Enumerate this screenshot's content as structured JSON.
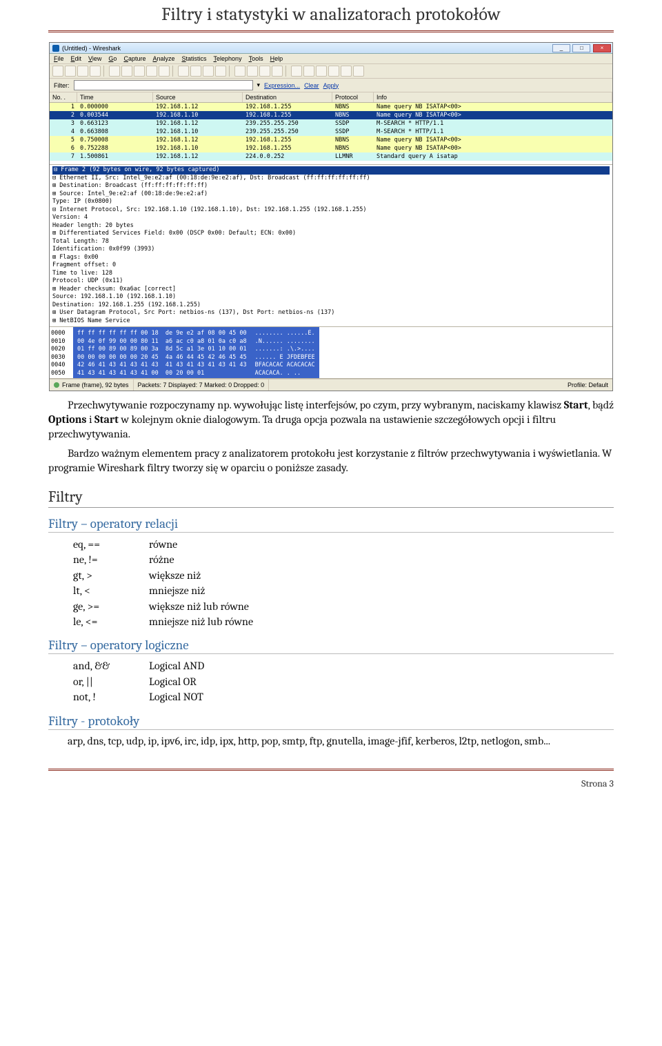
{
  "page": {
    "title": "Filtry i statystyki w analizatorach protokołów",
    "footer": "Strona 3"
  },
  "wireshark": {
    "window_title": "(Untitled) - Wireshark",
    "menu": [
      "File",
      "Edit",
      "View",
      "Go",
      "Capture",
      "Analyze",
      "Statistics",
      "Telephony",
      "Tools",
      "Help"
    ],
    "filter_label": "Filter:",
    "expression": "Expression...",
    "clear": "Clear",
    "apply": "Apply",
    "columns": {
      "no": "No. .",
      "time": "Time",
      "src": "Source",
      "dst": "Destination",
      "proto": "Protocol",
      "info": "Info"
    },
    "rows": [
      {
        "no": "1",
        "time": "0.000000",
        "src": "192.168.1.12",
        "dst": "192.168.1.255",
        "proto": "NBNS",
        "info": "Name query NB ISATAP<00>",
        "cls": "lemon"
      },
      {
        "no": "2",
        "time": "0.003544",
        "src": "192.168.1.10",
        "dst": "192.168.1.255",
        "proto": "NBNS",
        "info": "Name query NB ISATAP<00>",
        "cls": "sel"
      },
      {
        "no": "3",
        "time": "0.663123",
        "src": "192.168.1.12",
        "dst": "239.255.255.250",
        "proto": "SSDP",
        "info": "M-SEARCH * HTTP/1.1",
        "cls": "teal"
      },
      {
        "no": "4",
        "time": "0.663808",
        "src": "192.168.1.10",
        "dst": "239.255.255.250",
        "proto": "SSDP",
        "info": "M-SEARCH * HTTP/1.1",
        "cls": "teal"
      },
      {
        "no": "5",
        "time": "0.750008",
        "src": "192.168.1.12",
        "dst": "192.168.1.255",
        "proto": "NBNS",
        "info": "Name query NB ISATAP<00>",
        "cls": "lemon"
      },
      {
        "no": "6",
        "time": "0.752288",
        "src": "192.168.1.10",
        "dst": "192.168.1.255",
        "proto": "NBNS",
        "info": "Name query NB ISATAP<00>",
        "cls": "lemon"
      },
      {
        "no": "7",
        "time": "1.500861",
        "src": "192.168.1.12",
        "dst": "224.0.0.252",
        "proto": "LLMNR",
        "info": "Standard query A isatap",
        "cls": "teal"
      }
    ],
    "details": [
      "⊟ Frame 2 (92 bytes on wire, 92 bytes captured)",
      "⊟ Ethernet II, Src: Intel_9e:e2:af (00:18:de:9e:e2:af), Dst: Broadcast (ff:ff:ff:ff:ff:ff)",
      "  ⊞ Destination: Broadcast (ff:ff:ff:ff:ff:ff)",
      "  ⊞ Source: Intel_9e:e2:af (00:18:de:9e:e2:af)",
      "    Type: IP (0x0800)",
      "⊟ Internet Protocol, Src: 192.168.1.10 (192.168.1.10), Dst: 192.168.1.255 (192.168.1.255)",
      "    Version: 4",
      "    Header length: 20 bytes",
      "  ⊞ Differentiated Services Field: 0x00 (DSCP 0x00: Default; ECN: 0x00)",
      "    Total Length: 78",
      "    Identification: 0x0f99 (3993)",
      "  ⊞ Flags: 0x00",
      "    Fragment offset: 0",
      "    Time to live: 128",
      "    Protocol: UDP (0x11)",
      "  ⊞ Header checksum: 0xa6ac [correct]",
      "    Source: 192.168.1.10 (192.168.1.10)",
      "    Destination: 192.168.1.255 (192.168.1.255)",
      "⊞ User Datagram Protocol, Src Port: netbios-ns (137), Dst Port: netbios-ns (137)",
      "⊞ NetBIOS Name Service"
    ],
    "hex_offsets": [
      "0000",
      "0010",
      "0020",
      "0030",
      "0040",
      "0050"
    ],
    "hex_bytes": "ff ff ff ff ff ff 00 18  de 9e e2 af 08 00 45 00\n00 4e 0f 99 00 00 80 11  a6 ac c0 a8 01 0a c0 a8\n01 ff 00 89 00 89 00 3a  8d 5c a1 3e 01 10 00 01\n00 00 00 00 00 00 20 45  4a 46 44 45 42 46 45 45\n42 46 41 43 41 43 41 43  41 43 41 43 41 43 41 43\n41 43 41 43 41 43 41 00  00 20 00 01            ",
    "hex_ascii": "........ ......E.\n.N...... ........\n.......: .\\.>....\n...... E JFDEBFEE\nBFACACAC ACACACAC\nACACACA. . ..    ",
    "status_left": "Frame (frame), 92 bytes",
    "status_mid": "Packets: 7 Displayed: 7 Marked: 0 Dropped: 0",
    "status_right": "Profile: Default"
  },
  "article": {
    "p1_a": "Przechwytywanie rozpoczynamy np. wywołując listę interfejsów, po czym, przy wybranym, naciskamy klawisz ",
    "p1_b1": "Start",
    "p1_c": ", bądź ",
    "p1_b2": "Options",
    "p1_d": " i ",
    "p1_b3": "Start",
    "p1_e": " w kolejnym oknie dialogowym. Ta druga opcja pozwala na ustawienie szczegółowych opcji i filtru przechwytywania.",
    "p2": "Bardzo ważnym elementem pracy z analizatorem protokołu jest korzystanie z filtrów przechwytywania i wyświetlania. W programie Wireshark filtry tworzy się w oparciu o poniższe zasady.",
    "h_filtry": "Filtry",
    "h_rel": "Filtry – operatory relacji",
    "rel": [
      {
        "op": "eq, ==",
        "desc": "równe"
      },
      {
        "op": "ne, !=",
        "desc": "różne"
      },
      {
        "op": "gt, >",
        "desc": "większe niż"
      },
      {
        "op": "lt, <",
        "desc": "mniejsze niż"
      },
      {
        "op": "ge, >=",
        "desc": "większe niż lub równe"
      },
      {
        "op": "le, <=",
        "desc": "mniejsze niż lub równe"
      }
    ],
    "h_log": "Filtry – operatory logiczne",
    "log": [
      {
        "op": "and, &&",
        "desc": "Logical AND"
      },
      {
        "op": "or,  ||",
        "desc": "Logical OR"
      },
      {
        "op": "not, !",
        "desc": "Logical NOT"
      }
    ],
    "h_proto": "Filtry - protokoły",
    "proto": "arp, dns, tcp, udp, ip, ipv6, irc, idp, ipx, http, pop, smtp, ftp, gnutella, image-jfif, kerberos, l2tp, netlogon, smb..."
  }
}
